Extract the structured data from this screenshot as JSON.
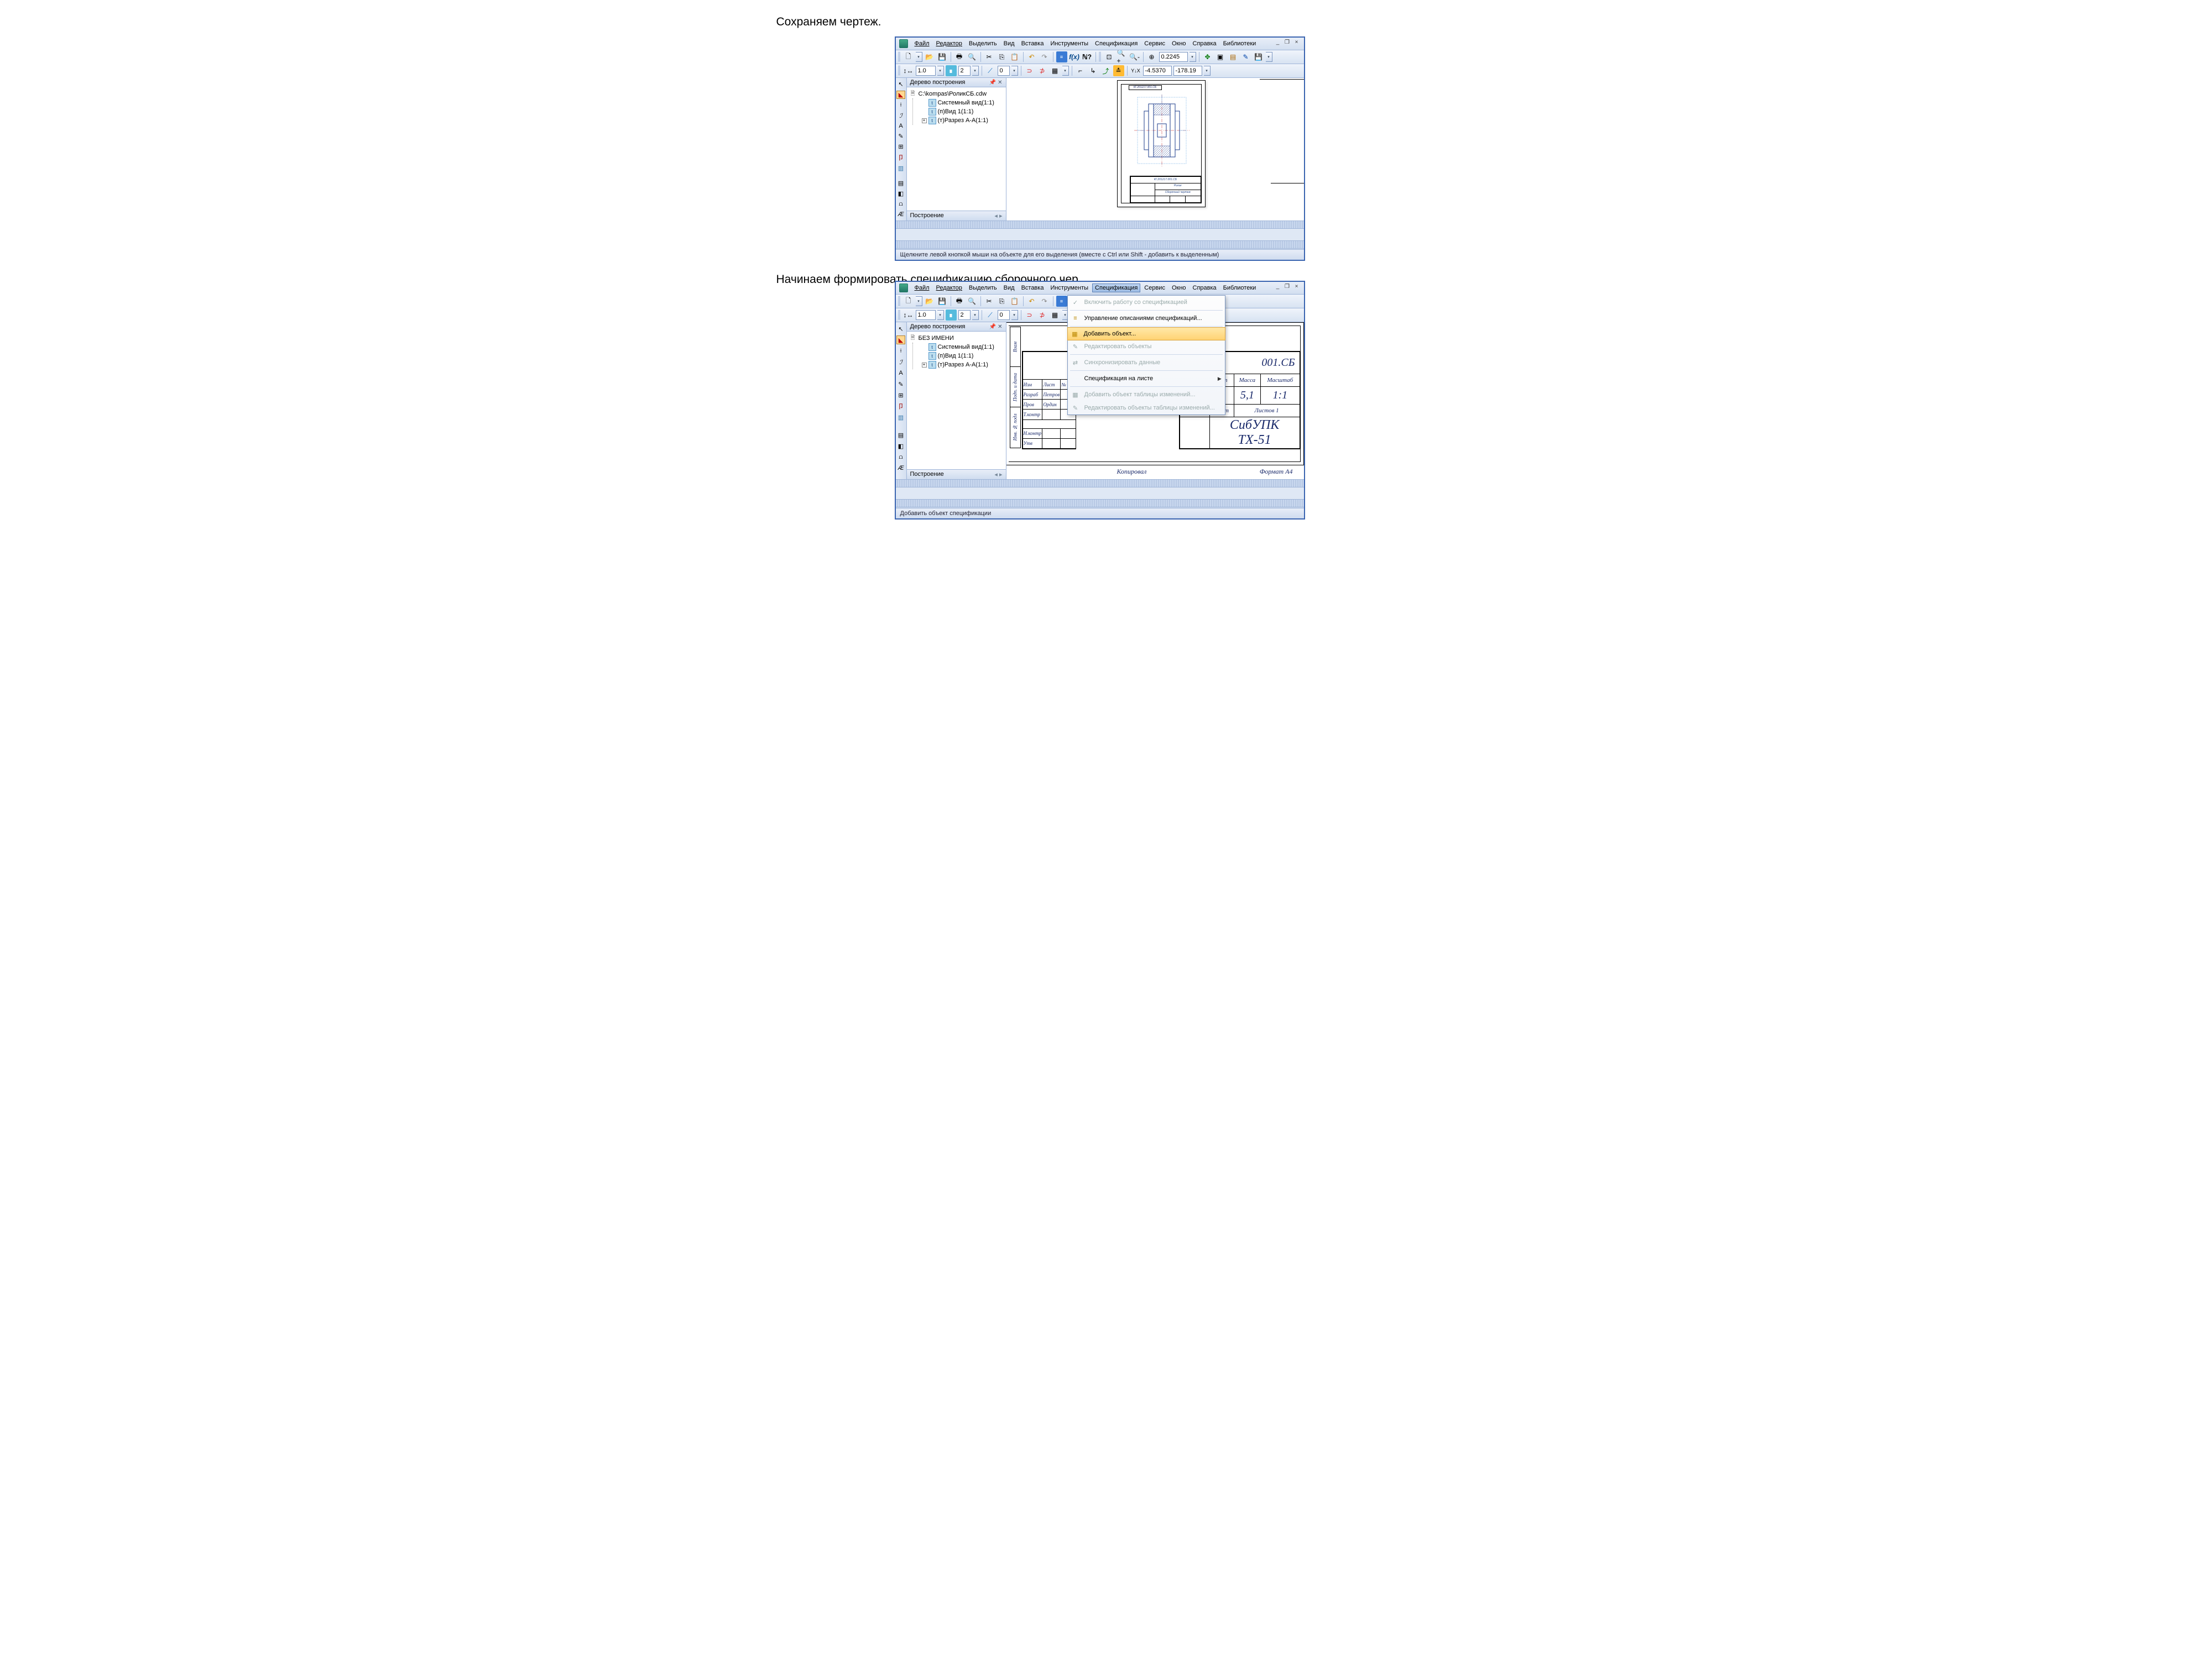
{
  "caption1": "Сохраняем чертеж.",
  "caption2": "Начинаем формировать спецификацию сборочного чер",
  "menubar": {
    "items": [
      "Файл",
      "Редактор",
      "Выделить",
      "Вид",
      "Вставка",
      "Инструменты",
      "Спецификация",
      "Сервис",
      "Окно",
      "Справка",
      "Библиотеки"
    ]
  },
  "win_controls": {
    "min": "_",
    "restore": "❐",
    "close": "×"
  },
  "toolbar1": {
    "zoom_value": "0.2245"
  },
  "toolbar2": {
    "scale": "1.0",
    "layer": "2",
    "style": "0",
    "coord_x": "-4.5370",
    "coord_y": "-178.19"
  },
  "tree1": {
    "title": "Дерево построения",
    "root": "C:\\kompas\\РоликСБ.cdw",
    "items": [
      "Системный вид(1:1)",
      "(п)Вид 1(1:1)",
      "(т)Разрез А-А(1:1)"
    ],
    "footer_tab": "Построение"
  },
  "tree2": {
    "title": "Дерево построения",
    "root": "БЕЗ ИМЕНИ",
    "items": [
      "Системный вид(1:1)",
      "(п)Вид 1(1:1)",
      "(т)Разрез А-А(1:1)"
    ],
    "footer_tab": "Построение"
  },
  "status1": "Щелкните левой кнопкой мыши на объекте для его выделения (вместе с Ctrl или Shift - добавить к выделенным)",
  "status2": "Добавить объект спецификации",
  "spec_menu": {
    "items": [
      {
        "label": "Включить работу со спецификацией",
        "icon": "✓",
        "disabled": true
      },
      {
        "label": "Управление описаниями спецификаций...",
        "icon": "≡",
        "disabled": false
      },
      {
        "label": "Добавить объект...",
        "icon": "▦",
        "disabled": false,
        "highlight": true
      },
      {
        "label": "Редактировать объекты",
        "icon": "✎",
        "disabled": true
      },
      {
        "label": "Синхронизировать данные",
        "icon": "⇄",
        "disabled": true
      },
      {
        "label": "Спецификация на листе",
        "icon": "",
        "disabled": false,
        "submenu": true
      },
      {
        "label": "Добавить объект таблицы изменений...",
        "icon": "▦",
        "disabled": true
      },
      {
        "label": "Редактировать объекты таблицы изменений...",
        "icon": "✎",
        "disabled": true
      }
    ]
  },
  "titleblock_small": {
    "designation": "КГ.201217.001.СБ",
    "name": "Ролик",
    "sub": "Сборочный чертеж"
  },
  "titleblock_big": {
    "designation_suffix": "001.СБ",
    "cols": [
      "Лит",
      "Масса",
      "Масштаб"
    ],
    "mass": "5,1",
    "scale": "1:1",
    "sheet": "Лист",
    "sheets": "Листов    1",
    "org": "СибУПК ТХ-51",
    "rows": [
      [
        "Изм",
        "Лист",
        "№ док"
      ],
      [
        "Разраб",
        "Петров",
        ""
      ],
      [
        "Пров",
        "Ордин",
        ""
      ],
      [
        "Т.контр",
        "",
        ""
      ],
      [
        "",
        "",
        ""
      ],
      [
        "Н.контр",
        "",
        ""
      ],
      [
        "Утв",
        "",
        ""
      ]
    ],
    "footer_left": "Копировал",
    "footer_right": "Формат    A4",
    "side_labels": [
      "Взам",
      "Подп. и дата",
      "Инв. № подл"
    ]
  },
  "sheet_header_text": "КГ.201217.001.СБ"
}
